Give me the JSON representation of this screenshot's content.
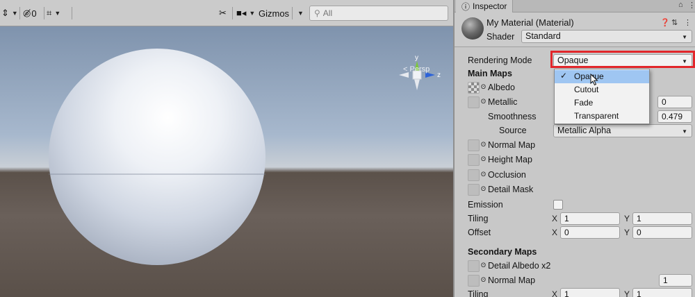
{
  "scene_toolbar": {
    "hidden_count": "0",
    "gizmos_label": "Gizmos",
    "search_placeholder": "All"
  },
  "scene_view": {
    "persp_label": "< Persp",
    "axis_y": "y",
    "axis_z": "z"
  },
  "inspector": {
    "tab_label": "Inspector",
    "material_name": "My Material (Material)",
    "shader_label": "Shader",
    "shader_value": "Standard",
    "rendering_mode_label": "Rendering Mode",
    "rendering_mode_value": "Opaque",
    "main_maps_header": "Main Maps",
    "albedo_label": "Albedo",
    "metallic_label": "Metallic",
    "metallic_value": "0",
    "smoothness_label": "Smoothness",
    "smoothness_value": "0.479",
    "source_label": "Source",
    "source_value": "Metallic Alpha",
    "normal_map_label": "Normal Map",
    "height_map_label": "Height Map",
    "occlusion_label": "Occlusion",
    "detail_mask_label": "Detail Mask",
    "emission_label": "Emission",
    "tiling_label": "Tiling",
    "tiling_x": "1",
    "tiling_y": "1",
    "offset_label": "Offset",
    "offset_x": "0",
    "offset_y": "0",
    "axis_x": "X",
    "axis_y": "Y",
    "secondary_maps_header": "Secondary Maps",
    "detail_albedo_label": "Detail Albedo x2",
    "secondary_normal_label": "Normal Map",
    "secondary_normal_value": "1",
    "secondary_tiling_label": "Tiling",
    "secondary_tiling_x": "1",
    "secondary_tiling_y": "1"
  },
  "dropdown": {
    "selected": "Opaque",
    "options": [
      "Opaque",
      "Cutout",
      "Fade",
      "Transparent"
    ]
  },
  "colors": {
    "highlight_border": "#e2262a",
    "menu_selection": "#9fc6f2",
    "gizmo_y": "#7ec83a",
    "gizmo_z": "#2d63d8"
  }
}
